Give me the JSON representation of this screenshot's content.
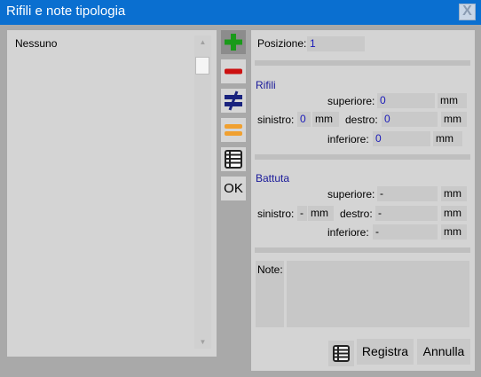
{
  "window": {
    "title": "Rifili e note tipologia",
    "close_label": "X"
  },
  "list": {
    "items": [
      "Nessuno"
    ],
    "scroll_up": "▲",
    "scroll_down": "▼"
  },
  "toolbar": {
    "ok_label": "OK",
    "add_color": "#1a9a1a",
    "remove_color": "#cc1111",
    "diff_color": "#1a237e",
    "equal_color": "#f0a030"
  },
  "form": {
    "position_label": "Posizione:",
    "position_value": "1",
    "rifili": {
      "title": "Rifili",
      "top_label": "superiore:",
      "top_value": "0",
      "top_unit": "mm",
      "left_label": "sinistro:",
      "left_value": "0",
      "left_unit": "mm",
      "right_label": "destro:",
      "right_value": "0",
      "right_unit": "mm",
      "bottom_label": "inferiore:",
      "bottom_value": "0",
      "bottom_unit": "mm"
    },
    "battuta": {
      "title": "Battuta",
      "top_label": "superiore:",
      "top_value": "-",
      "top_unit": "mm",
      "left_label": "sinistro:",
      "left_value": "-",
      "left_unit": "mm",
      "right_label": "destro:",
      "right_value": "-",
      "right_unit": "mm",
      "bottom_label": "inferiore:",
      "bottom_value": "-",
      "bottom_unit": "mm"
    },
    "note_label": "Note:",
    "note_value": ""
  },
  "actions": {
    "save_label": "Registra",
    "cancel_label": "Annulla"
  }
}
